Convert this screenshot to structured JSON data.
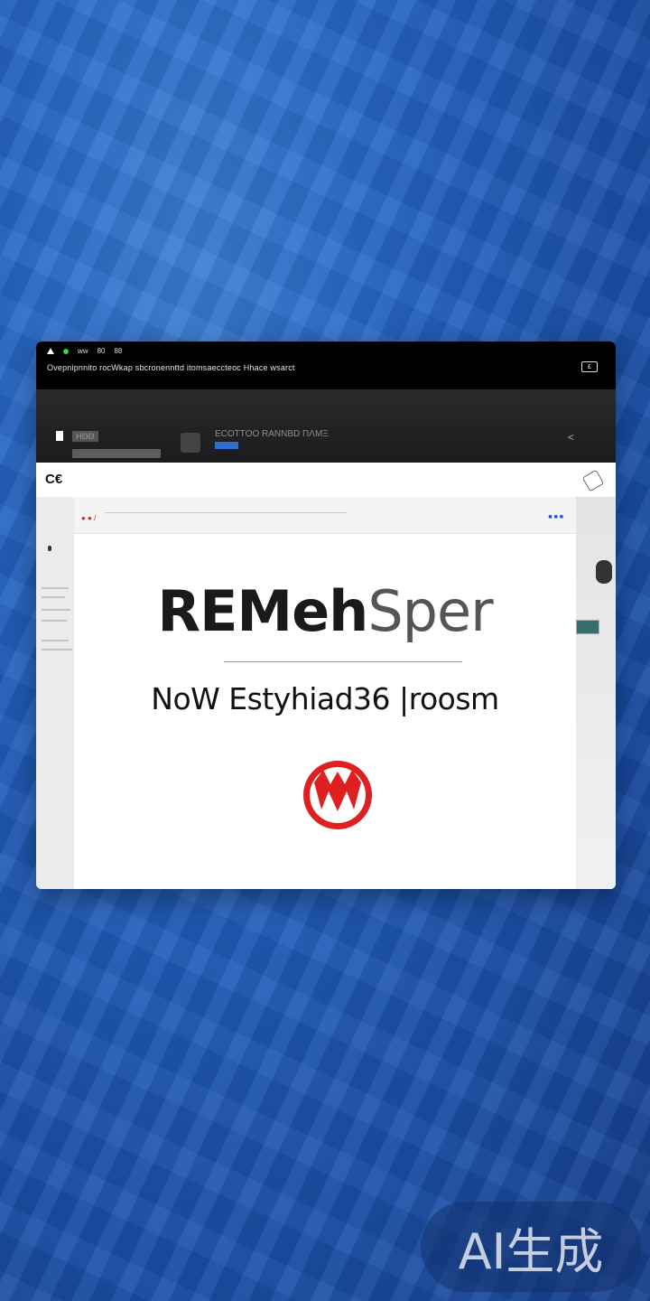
{
  "status_bar": {
    "items": [
      "ww",
      "80",
      "88"
    ],
    "url": "Ovepnipnnito rocWkap sbcronennttd itomsaeccteoc Hhace wsarct",
    "tab_indicator": "£"
  },
  "hero": {
    "label": "ΗΘΘ",
    "breadcrumb": "ECOTTOO RANNBD ΠΛΜΞ",
    "arrow": "<"
  },
  "navbar": {
    "logo": "C€",
    "logo_icon": "brand-mark-icon",
    "tool_icon": "tag-icon"
  },
  "content_header": {
    "mini_label": "● ● /",
    "right_label": "■ ■ ■"
  },
  "main": {
    "title_part1": "REMeh",
    "title_part2": "Sper",
    "subtitle": "NoW Estyhiad36 |roosm",
    "emblem_icon": "red-circle-emblem-icon",
    "emblem_color": "#e02020"
  },
  "watermark": {
    "text": "AI生成"
  },
  "colors": {
    "background": "#2463c2",
    "titlebar": "#000000",
    "accent_blue": "#2e6fd1",
    "accent_red": "#e02020"
  }
}
